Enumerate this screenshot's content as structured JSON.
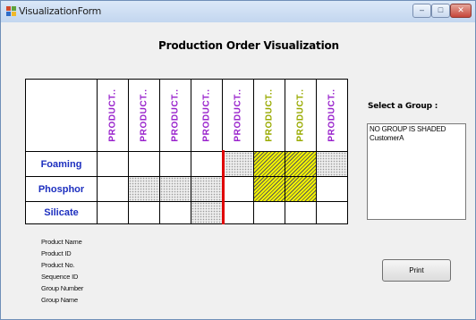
{
  "window": {
    "title": "VisualizationForm",
    "icon": "app-icon",
    "controls": [
      "minimize-icon",
      "maximize-icon",
      "close-icon"
    ]
  },
  "heading": "Production Order Visualization",
  "grid": {
    "columns": [
      {
        "label": "PRODUCT..",
        "color": "#9922cc"
      },
      {
        "label": "PRODUCT..",
        "color": "#9922cc"
      },
      {
        "label": "PRODUCT..",
        "color": "#9922cc"
      },
      {
        "label": "PRODUCT..",
        "color": "#9922cc"
      },
      {
        "label": "PRODUCT..",
        "color": "#9922cc"
      },
      {
        "label": "PRODUCT..",
        "color": "#99aa00"
      },
      {
        "label": "PRODUCT..",
        "color": "#99aa00"
      },
      {
        "label": "PRODUCT..",
        "color": "#9922cc"
      }
    ],
    "rows": [
      {
        "label": "Foaming",
        "cells": [
          "",
          "",
          "",
          "",
          "dotted",
          "hatched",
          "hatched",
          "dotted"
        ]
      },
      {
        "label": "Phosphor",
        "cells": [
          "",
          "dotted",
          "dotted",
          "dotted",
          "",
          "hatched",
          "hatched",
          ""
        ]
      },
      {
        "label": "Silicate",
        "cells": [
          "",
          "",
          "",
          "dotted",
          "",
          "",
          "",
          ""
        ]
      }
    ],
    "row_label_color": "#1d2fbf",
    "divider_color": "#e00000",
    "highlight_color": "#f2f200"
  },
  "group": {
    "label": "Select a Group :",
    "items": [
      "NO GROUP IS SHADED",
      "CustomerA"
    ]
  },
  "info_labels": [
    "Product Name",
    "Product ID",
    "Product No.",
    "Sequence ID",
    "Group Number",
    "Group Name"
  ],
  "print_label": "Print"
}
